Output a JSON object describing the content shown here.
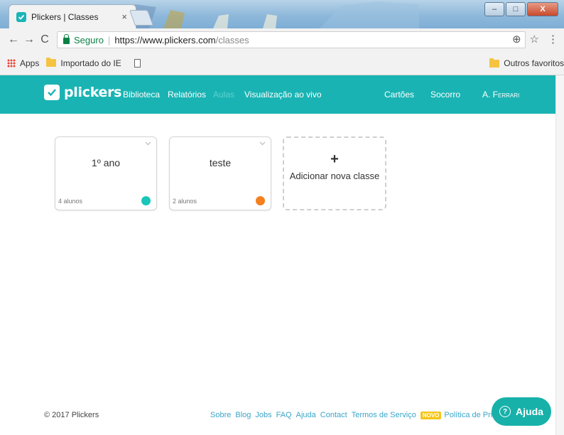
{
  "browser": {
    "tab_title": "Plickers | Classes",
    "tab_close": "×",
    "window_controls": {
      "min": "–",
      "max": "□",
      "close": "X"
    },
    "nav": {
      "back": "←",
      "forward": "→",
      "reload": "C"
    },
    "secure_label": "Seguro",
    "url_main": "https://www.plickers.com",
    "url_path": "/classes",
    "toolbar_icons": {
      "translate": "⊕",
      "star": "☆",
      "menu": "⋮"
    },
    "bookmarks": {
      "apps": "Apps",
      "imported": "Importado do IE",
      "others": "Outros favoritos"
    }
  },
  "app": {
    "brand_color": "#1ab3b3",
    "logo_text": "plickers",
    "nav_links": {
      "biblioteca": "Biblioteca",
      "relatorios": "Relatórios",
      "aulas": "Aulas",
      "ao_vivo": "Visualização ao vivo",
      "cartoes": "Cartões",
      "socorro": "Socorro",
      "user": "A. Ferrari"
    }
  },
  "classes": [
    {
      "name": "1º ano",
      "count": "4 alunos",
      "color": "#1ac6b9"
    },
    {
      "name": "teste",
      "count": "2 alunos",
      "color": "#f5801f"
    }
  ],
  "add_class": {
    "plus": "+",
    "label": "Adicionar nova classe"
  },
  "footer": {
    "copyright": "© 2017 Plickers",
    "links": {
      "sobre": "Sobre",
      "blog": "Blog",
      "jobs": "Jobs",
      "faq": "FAQ",
      "ajuda": "Ajuda",
      "contact": "Contact",
      "termos": "Termos de Serviço",
      "novo": "NOVO",
      "privacidade": "Política de Privacidade"
    },
    "help_button": "Ajuda",
    "help_icon_glyph": "?"
  }
}
